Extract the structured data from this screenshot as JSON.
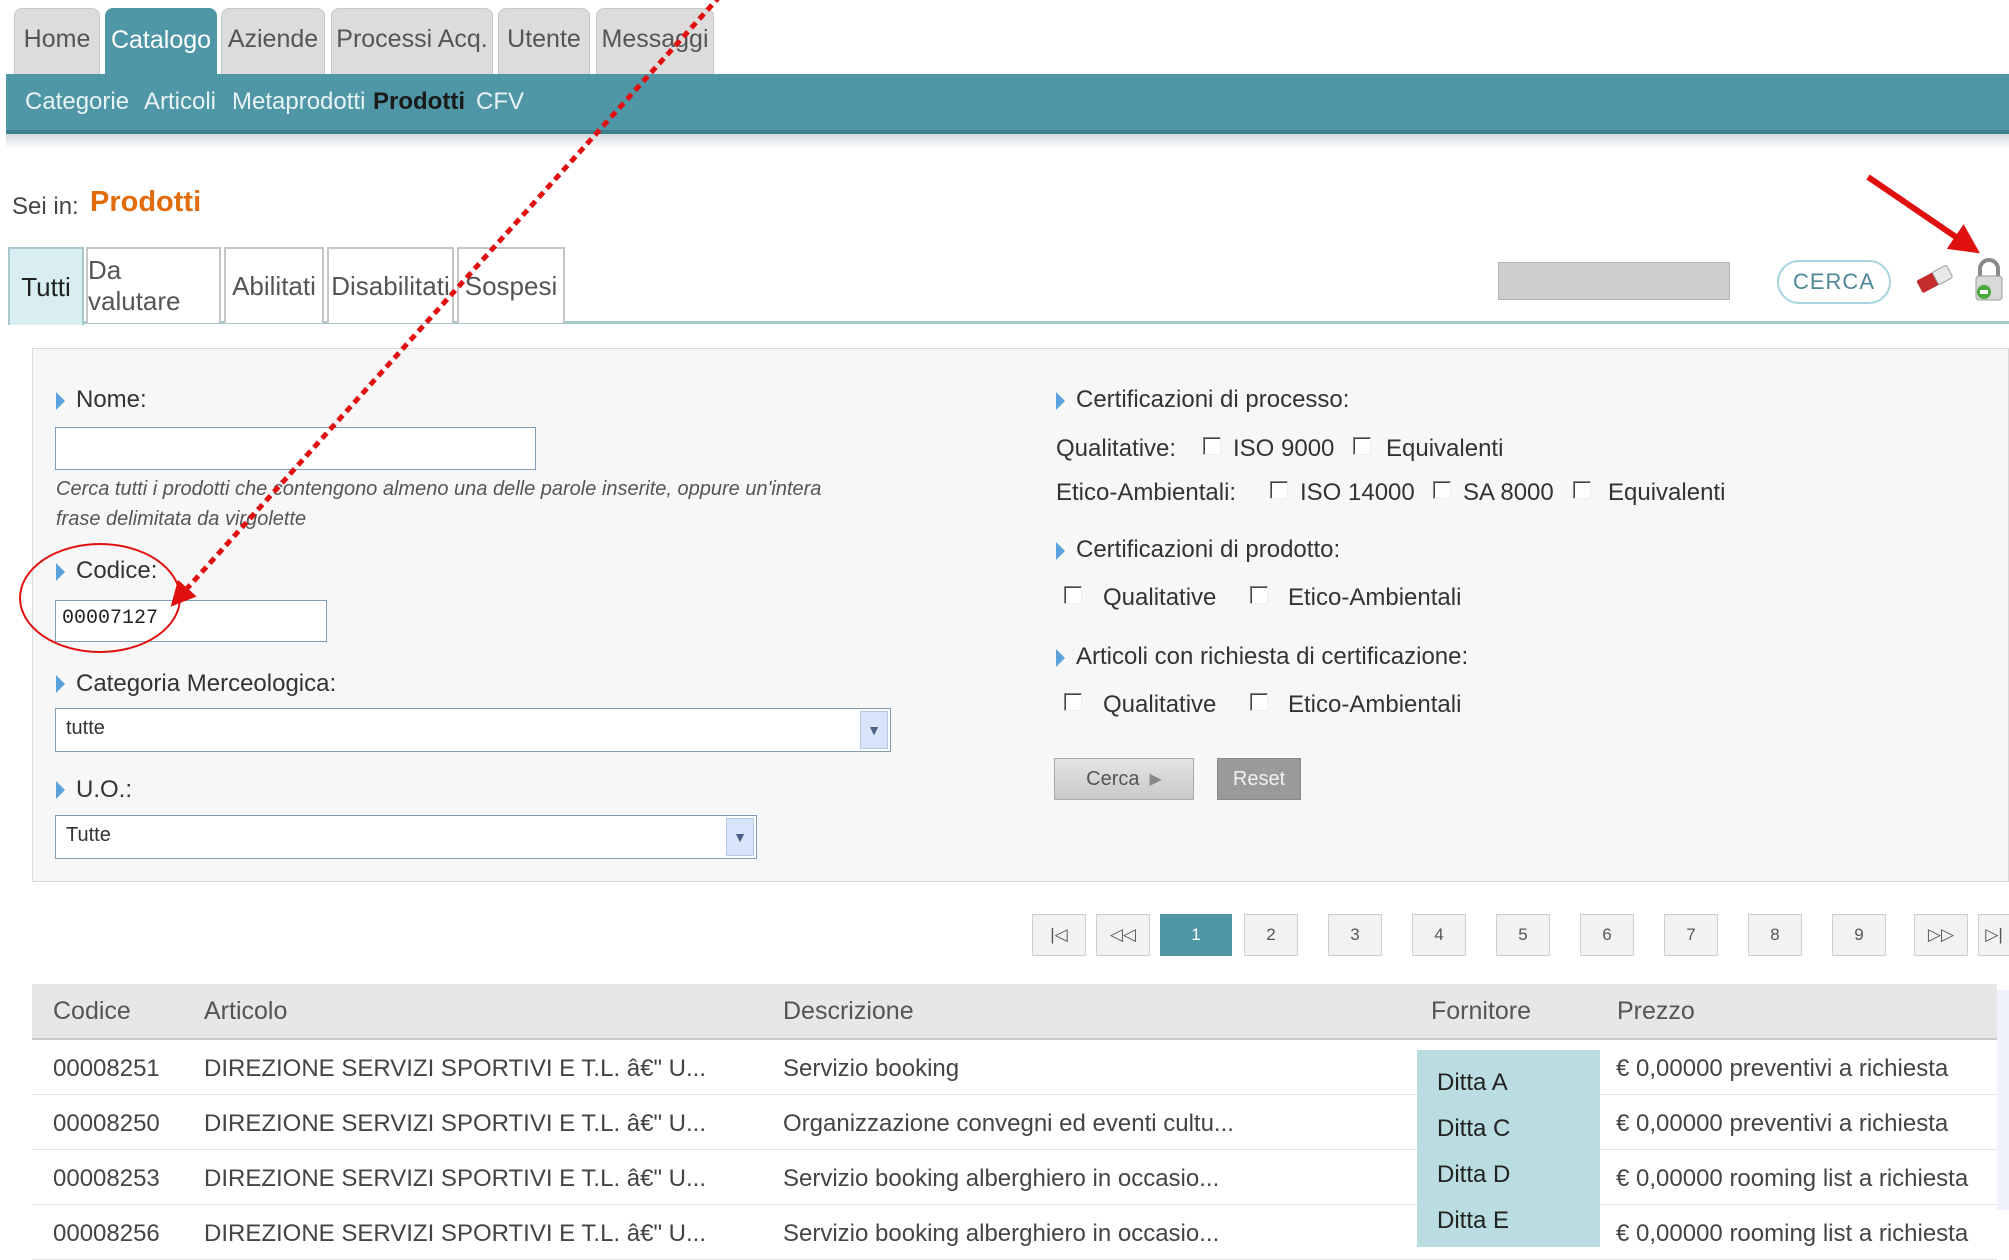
{
  "main_nav": {
    "tabs": [
      {
        "label": "Home"
      },
      {
        "label": "Catalogo"
      },
      {
        "label": "Aziende"
      },
      {
        "label": "Processi Acq."
      },
      {
        "label": "Utente"
      },
      {
        "label": "Messaggi"
      }
    ],
    "active": "Catalogo"
  },
  "sub_nav": {
    "items": [
      {
        "label": "Categorie"
      },
      {
        "label": "Articoli"
      },
      {
        "label": "Metaprodotti"
      },
      {
        "label": "Prodotti"
      },
      {
        "label": "CFV"
      }
    ],
    "active": "Prodotti"
  },
  "breadcrumb": {
    "label": "Sei in:",
    "value": "Prodotti"
  },
  "status_tabs": {
    "items": [
      {
        "label": "Tutti"
      },
      {
        "label": "Da valutare"
      },
      {
        "label": "Abilitati"
      },
      {
        "label": "Disabilitati"
      },
      {
        "label": "Sospesi"
      }
    ],
    "active": "Tutti"
  },
  "quick_search": {
    "value": "",
    "button_label": "CERCA"
  },
  "filters": {
    "nome": {
      "label": "Nome:",
      "value": "",
      "hint_line1": "Cerca tutti i prodotti che contengono almeno una delle parole inserite, oppure un'intera",
      "hint_line2": "frase delimitata da virgolette"
    },
    "codice": {
      "label": "Codice:",
      "value": "00007127"
    },
    "categoria": {
      "label": "Categoria Merceologica:",
      "selected": "tutte"
    },
    "uo": {
      "label": "U.O.:",
      "selected": "Tutte"
    },
    "cert_processo": {
      "label": "Certificazioni di processo:",
      "qualitative_label": "Qualitative:",
      "qualitative_options": [
        "ISO 9000",
        "Equivalenti"
      ],
      "etico_label": "Etico-Ambientali:",
      "etico_options": [
        "ISO 14000",
        "SA 8000",
        "Equivalenti"
      ]
    },
    "cert_prodotto": {
      "label": "Certificazioni di prodotto:",
      "options": [
        "Qualitative",
        "Etico-Ambientali"
      ]
    },
    "articoli_cert": {
      "label": "Articoli con richiesta di certificazione:",
      "options": [
        "Qualitative",
        "Etico-Ambientali"
      ]
    },
    "search_button": "Cerca",
    "reset_button": "Reset"
  },
  "pagination": {
    "pages": [
      "1",
      "2",
      "3",
      "4",
      "5",
      "6",
      "7",
      "8",
      "9"
    ],
    "current": "1"
  },
  "table": {
    "columns": [
      "Codice",
      "Articolo",
      "Descrizione",
      "Fornitore",
      "Prezzo"
    ],
    "rows": [
      {
        "codice": "00008251",
        "articolo": "DIREZIONE SERVIZI SPORTIVI E T.L. â€\" U...",
        "descrizione": "Servizio booking",
        "fornitore": "Ditta A",
        "prezzo": "€ 0,00000 preventivi a richiesta"
      },
      {
        "codice": "00008250",
        "articolo": "DIREZIONE SERVIZI SPORTIVI E T.L. â€\" U...",
        "descrizione": "Organizzazione convegni ed eventi cultu...",
        "fornitore": "Ditta C",
        "prezzo": "€ 0,00000 preventivi a richiesta"
      },
      {
        "codice": "00008253",
        "articolo": "DIREZIONE SERVIZI SPORTIVI E T.L. â€\" U...",
        "descrizione": "Servizio booking alberghiero in occasio...",
        "fornitore": "Ditta D",
        "prezzo": "€ 0,00000 rooming list a richiesta"
      },
      {
        "codice": "00008256",
        "articolo": "DIREZIONE SERVIZI SPORTIVI E T.L. â€\" U...",
        "descrizione": "Servizio booking alberghiero in occasio...",
        "fornitore": "Ditta E",
        "prezzo": "€ 0,00000 rooming list a richiesta"
      }
    ]
  },
  "colors": {
    "accent": "#4f96a6",
    "breadcrumb": "#e26c0c",
    "annotation": "#e01010"
  },
  "icons": [
    "eraser-icon",
    "lock-icon",
    "bullet-triangle-icon",
    "dropdown-arrow-icon",
    "first-page-icon",
    "prev-page-icon",
    "next-page-icon",
    "last-page-icon",
    "annotation-arrow",
    "annotation-circle"
  ]
}
